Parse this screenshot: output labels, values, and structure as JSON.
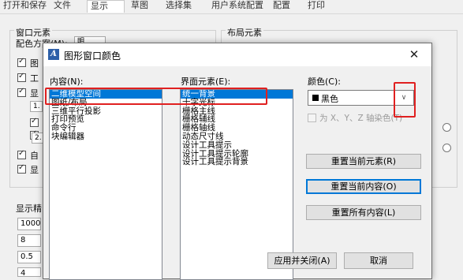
{
  "background": {
    "tabs": [
      "打开和保存",
      "文件",
      "显示",
      "草图",
      "选择集",
      "用户系统配置",
      "配置",
      "打印"
    ],
    "window_elements_title": "窗口元素",
    "color_scheme_label": "配色方案(M):",
    "color_scheme_value": "明",
    "layout_elements_title": "布局元素",
    "display_precision_title": "显示精",
    "inputs": [
      "1000",
      "8",
      "0.5",
      "4"
    ],
    "list_digits": [
      "1.",
      "2."
    ],
    "side_fragments": [
      "自",
      "显",
      "图",
      "工",
      "显"
    ]
  },
  "dialog": {
    "title": "图形窗口颜色",
    "close_glyph": "✕",
    "context_label": "内容(N):",
    "context_items": [
      "二维模型空间",
      "图纸/布局",
      "三维平行投影",
      "打印预览",
      "命令行",
      "块编辑器"
    ],
    "context_selected": 0,
    "interface_label": "界面元素(E):",
    "interface_items": [
      "统一背景",
      "十字光标",
      "栅格主线",
      "栅格辅线",
      "栅格轴线",
      "动态尺寸线",
      "设计工具提示",
      "设计工具提示轮廓",
      "设计工具提示背景"
    ],
    "interface_selected": 0,
    "color_label": "颜色(C):",
    "color_value": "黑色",
    "color_swatch": "#000000",
    "tint_label": "为 X、Y、Z 轴染色(T)",
    "restore_element": "重置当前元素(R)",
    "restore_context": "重置当前内容(O)",
    "restore_all": "重置所有内容(L)",
    "apply_close": "应用并关闭(A)",
    "cancel": "取消"
  },
  "colors": {
    "selection": "#0078d7",
    "annotation": "#e02020"
  }
}
